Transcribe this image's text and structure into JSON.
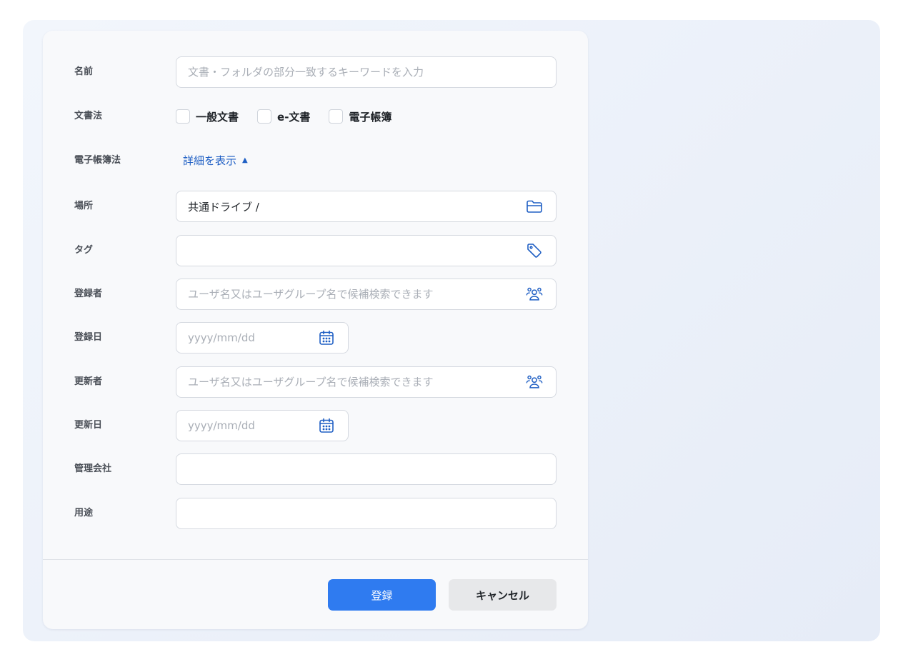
{
  "form": {
    "name": {
      "label": "名前",
      "placeholder": "文書・フォルダの部分一致するキーワードを入力"
    },
    "doc_law": {
      "label": "文書法",
      "options": [
        {
          "label": "一般文書",
          "checked": false
        },
        {
          "label": "e-文書",
          "checked": false
        },
        {
          "label": "電子帳簿",
          "checked": false
        }
      ]
    },
    "ebook_law": {
      "label": "電子帳簿法",
      "toggle_label": "詳細を表示",
      "toggle_icon": "▲"
    },
    "location": {
      "label": "場所",
      "value": "共通ドライブ /",
      "icon": "folder-icon"
    },
    "tag": {
      "label": "タグ",
      "value": "",
      "icon": "tag-icon"
    },
    "registrant": {
      "label": "登録者",
      "placeholder": "ユーザ名又はユーザグループ名で候補検索できます",
      "icon": "users-icon"
    },
    "registered_date": {
      "label": "登録日",
      "placeholder": "yyyy/mm/dd",
      "icon": "calendar-icon"
    },
    "updater": {
      "label": "更新者",
      "placeholder": "ユーザ名又はユーザグループ名で候補検索できます",
      "icon": "users-icon"
    },
    "updated_date": {
      "label": "更新日",
      "placeholder": "yyyy/mm/dd",
      "icon": "calendar-icon"
    },
    "company": {
      "label": "管理会社",
      "value": ""
    },
    "purpose": {
      "label": "用途",
      "value": ""
    }
  },
  "actions": {
    "submit_label": "登録",
    "cancel_label": "キャンセル"
  },
  "colors": {
    "accent": "#2f7bf0",
    "link": "#1f5fc4",
    "icon": "#1f5fc4"
  }
}
